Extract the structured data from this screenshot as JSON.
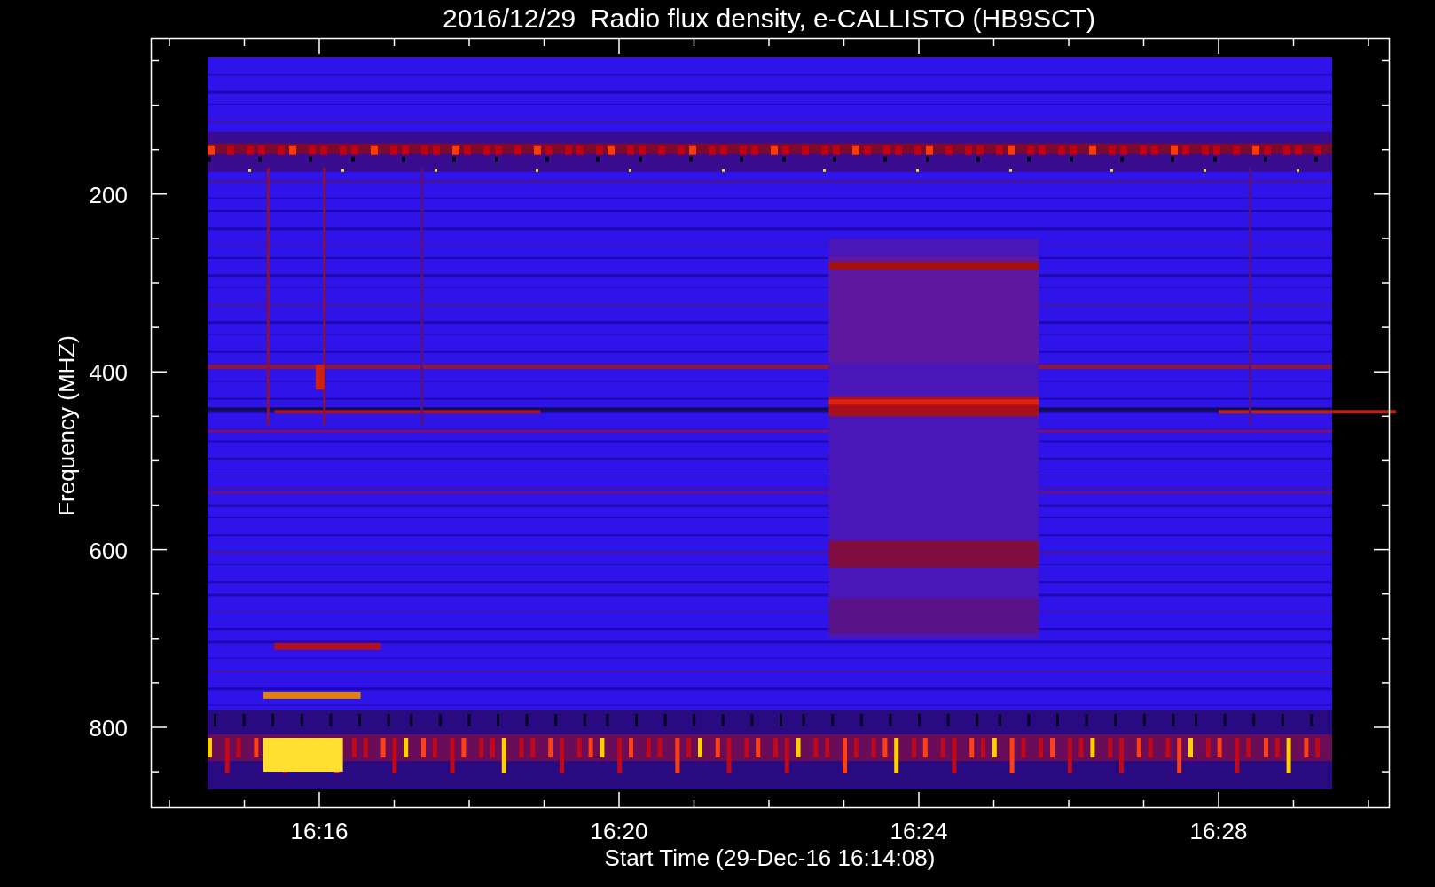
{
  "title": "2016/12/29  Radio flux density, e-CALLISTO (HB9SCT)",
  "xlabel": "Start Time (29-Dec-16 16:14:08)",
  "ylabel": "Frequency (MHZ)",
  "xticks": [
    "16:16",
    "16:20",
    "16:24",
    "16:28"
  ],
  "yticks": [
    "200",
    "400",
    "600",
    "800"
  ]
}
